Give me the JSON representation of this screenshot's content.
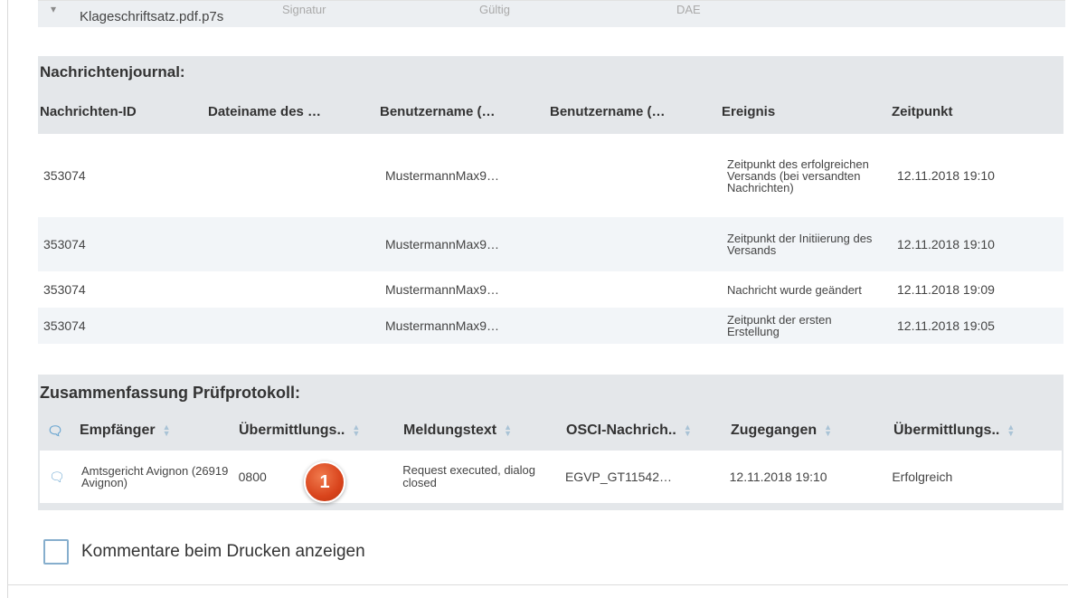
{
  "top_strip": {
    "icon": "file-icon",
    "filename": "Klageschriftsatz.pdf.p7s",
    "faded_1": "Signatur",
    "faded_2": "Gültig",
    "faded_3": "DAE"
  },
  "journal": {
    "title": "Nachrichtenjournal:",
    "columns": [
      "Nachrichten-ID",
      "Dateiname des …",
      "Benutzername (…",
      "Benutzername (…",
      "Ereignis",
      "Zeitpunkt"
    ],
    "rows": [
      {
        "id": "353074",
        "file": "",
        "user1": "MustermannMax9…",
        "user2": "",
        "event": "Zeitpunkt des erfolgreichen Versands (bei versandten Nachrichten)",
        "time": "12.11.2018 19:10"
      },
      {
        "id": "353074",
        "file": "",
        "user1": "MustermannMax9…",
        "user2": "",
        "event": "Zeitpunkt der Initiierung des Versands",
        "time": "12.11.2018 19:10"
      },
      {
        "id": "353074",
        "file": "",
        "user1": "MustermannMax9…",
        "user2": "",
        "event": "Nachricht wurde geändert",
        "time": "12.11.2018 19:09"
      },
      {
        "id": "353074",
        "file": "",
        "user1": "MustermannMax9…",
        "user2": "",
        "event": "Zeitpunkt der ersten Erstellung",
        "time": "12.11.2018 19:05"
      }
    ]
  },
  "protocol": {
    "title": "Zusammenfassung Prüfprotokoll:",
    "columns": [
      "Empfänger",
      "Übermittlungs..",
      "Meldungstext",
      "OSCI-Nachrich..",
      "Zugegangen",
      "Übermittlungs.."
    ],
    "row": {
      "recipient": "Amtsgericht Avignon (26919 Avignon)",
      "code": "0800",
      "message": "Request executed, dialog closed",
      "osci": "EGVP_GT11542…",
      "received": "12.11.2018 19:10",
      "status": "Erfolgreich"
    },
    "badge": "1",
    "accent_color": "#6aa6d1",
    "badge_color": "#d9441c"
  },
  "options": {
    "show_comments_label": "Kommentare beim Drucken anzeigen"
  }
}
